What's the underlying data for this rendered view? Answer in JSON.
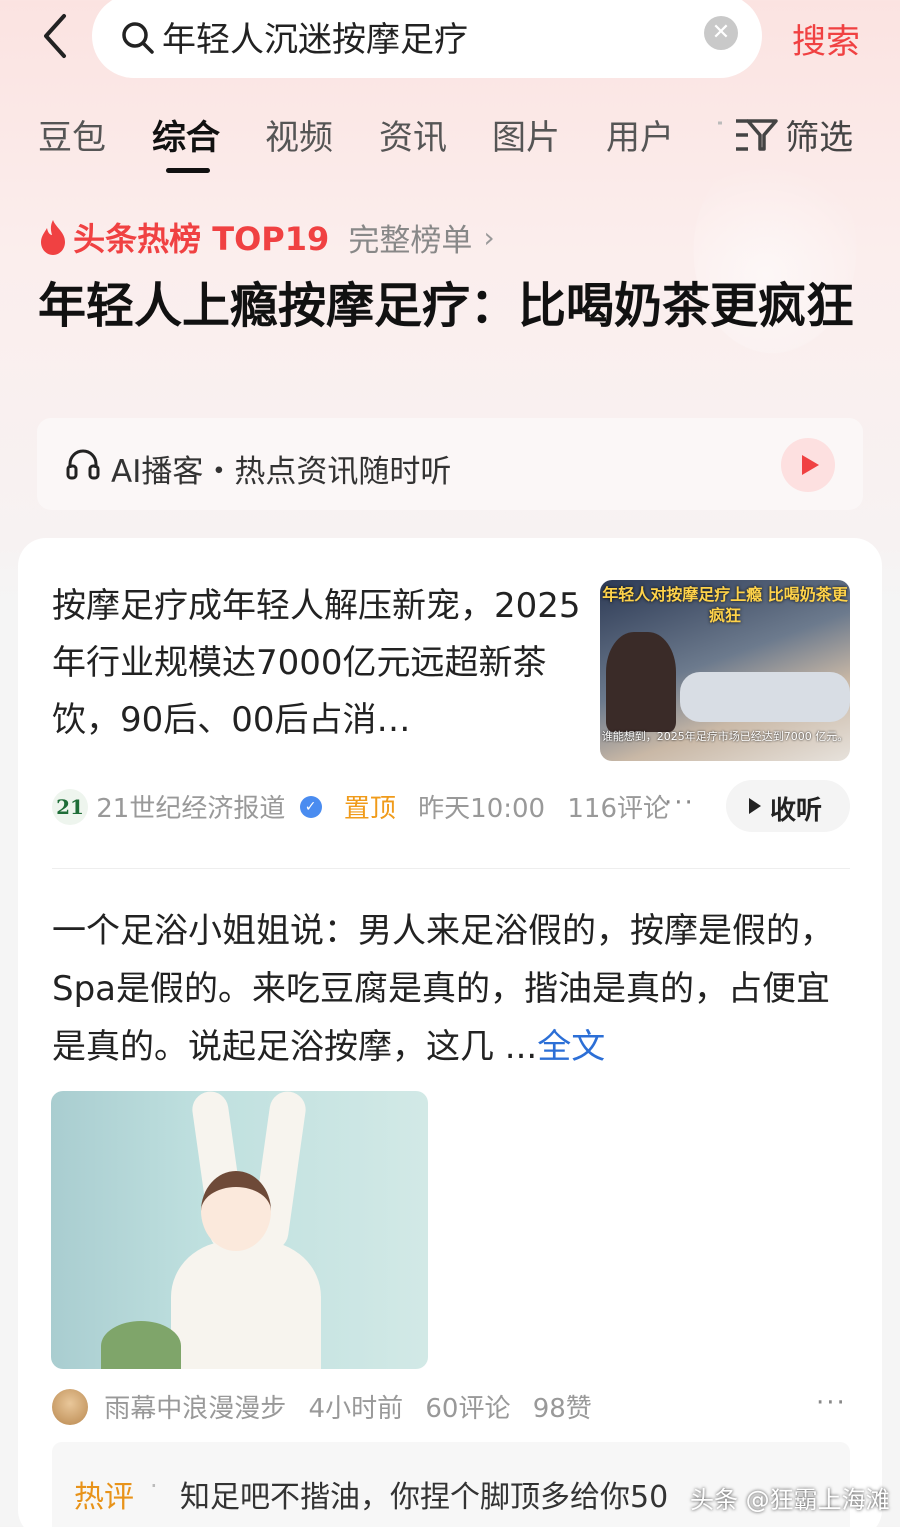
{
  "search": {
    "query": "年轻人沉迷按摩足疗",
    "button": "搜索"
  },
  "tabs": [
    {
      "label": "豆包"
    },
    {
      "label": "综合"
    },
    {
      "label": "视频"
    },
    {
      "label": "资讯"
    },
    {
      "label": "图片"
    },
    {
      "label": "用户"
    }
  ],
  "active_tab": "综合",
  "filter_label": "筛选",
  "hotrank": {
    "label": "头条热榜 TOP19",
    "full_list": "完整榜单"
  },
  "headline": "年轻人上瘾按摩足疗：比喝奶茶更疯狂",
  "podcast": {
    "text": "AI播客・热点资讯随时听"
  },
  "article1": {
    "title": "按摩足疗成年轻人解压新宠，2025年行业规模达7000亿元远超新茶饮，90后、00后占消…",
    "thumb_caption": "年轻人对按摩足疗上瘾 比喝奶茶更疯狂",
    "thumb_sub": "谁能想到，2025年足疗市场已经达到7000 亿元。",
    "source_logo": "21",
    "source": "21世纪经济报道",
    "pinned": "置顶",
    "time": "昨天10:00",
    "comments": "116评论",
    "listen": "收听"
  },
  "article2": {
    "body": "一个足浴小姐姐说：男人来足浴假的，按摩是假的，Spa是假的。来吃豆腐是真的，揩油是真的，占便宜是真的。说起足浴按摩，这几 ...",
    "full_text": "全文",
    "author": "雨幕中浪漫漫步",
    "time": "4小时前",
    "comments": "60评论",
    "likes": "98赞"
  },
  "hot_comment": {
    "label": "热评",
    "text": "知足吧不揩油，你捏个脚顶多给你50"
  },
  "watermark": "头条 @狂霸上海滩",
  "colors": {
    "accent_red": "#f04142",
    "pin_orange": "#f09b1a",
    "link_blue": "#2c6fd6"
  }
}
